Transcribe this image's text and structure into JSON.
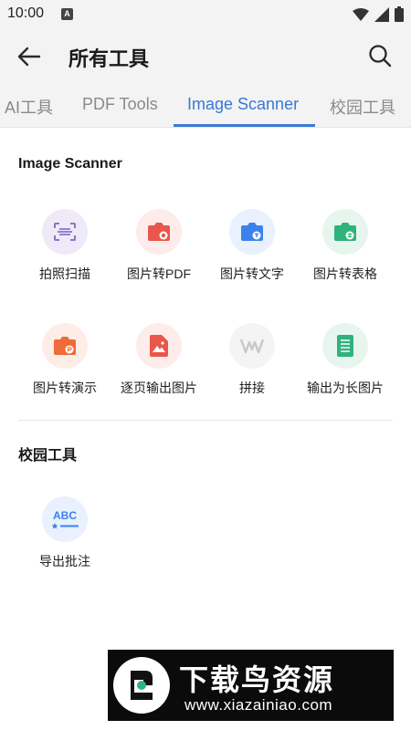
{
  "status_bar": {
    "time": "10:00",
    "notification_badge": "A"
  },
  "app_bar": {
    "title": "所有工具"
  },
  "tabs": [
    {
      "label": "AI工具",
      "active": false
    },
    {
      "label": "PDF Tools",
      "active": false
    },
    {
      "label": "Image Scanner",
      "active": true
    },
    {
      "label": "校园工具",
      "active": false
    }
  ],
  "sections": {
    "image_scanner": {
      "title": "Image Scanner",
      "tools": [
        {
          "label": "拍照扫描",
          "icon": "scan-icon",
          "color": "#8a74c9"
        },
        {
          "label": "图片转PDF",
          "icon": "camera-pdf-icon",
          "color": "#e8564c"
        },
        {
          "label": "图片转文字",
          "icon": "camera-text-icon",
          "color": "#3d82ea"
        },
        {
          "label": "图片转表格",
          "icon": "camera-table-icon",
          "color": "#2fb37c"
        },
        {
          "label": "图片转演示",
          "icon": "camera-slides-icon",
          "color": "#f06a3a"
        },
        {
          "label": "逐页输出图片",
          "icon": "image-export-icon",
          "color": "#e8564c"
        },
        {
          "label": "拼接",
          "icon": "stitch-icon",
          "color": "#c8c8c8"
        },
        {
          "label": "输出为长图片",
          "icon": "long-image-icon",
          "color": "#2fb37c"
        }
      ]
    },
    "campus": {
      "title": "校园工具",
      "tools": [
        {
          "label": "导出批注",
          "icon": "abc-annotation-icon",
          "color": "#3d82ea"
        }
      ]
    }
  },
  "watermark": {
    "title": "下载鸟资源",
    "url": "www.xiazainiao.com"
  }
}
